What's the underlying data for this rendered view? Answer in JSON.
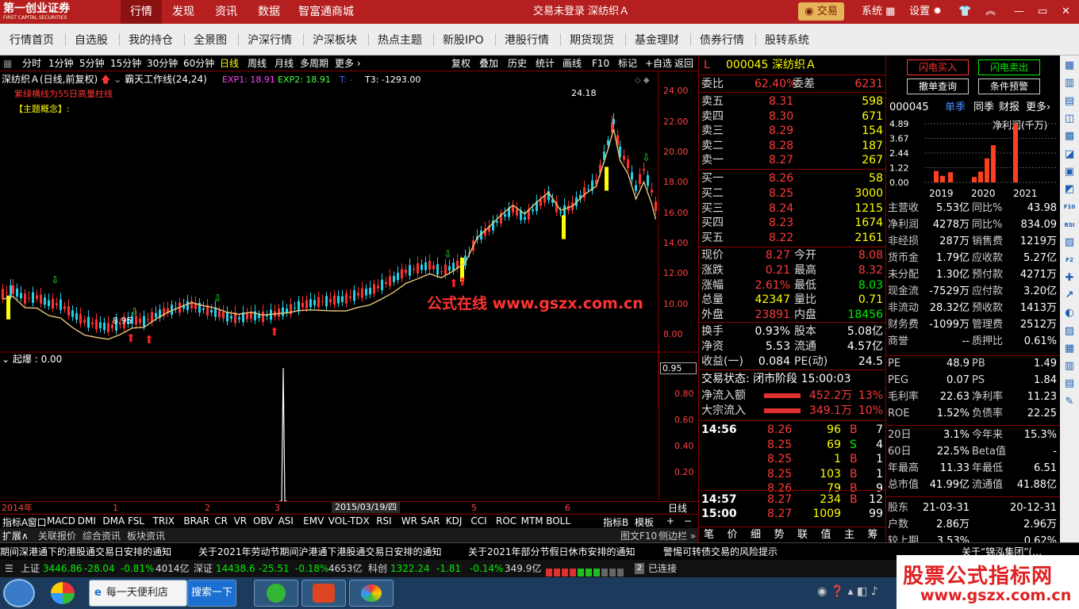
{
  "topbar": {
    "logo": "第一创业证券",
    "logo_en": "FIRST CAPITAL SECURITIES",
    "tabs": [
      "行情",
      "发现",
      "资讯",
      "数据",
      "智富通商城"
    ],
    "account": "交易未登录  深纺织Ａ",
    "trade": "交易",
    "system": "系统",
    "settings": "设置"
  },
  "nav": [
    "行情首页",
    "自选股",
    "我的持仓",
    "全景图",
    "沪深行情",
    "沪深板块",
    "热点主题",
    "新股IPO",
    "港股行情",
    "期货现货",
    "基金理财",
    "债券行情",
    "股转系统"
  ],
  "periods": [
    "分时",
    "1分钟",
    "5分钟",
    "15分钟",
    "30分钟",
    "60分钟",
    "日线",
    "周线",
    "月线",
    "多周期",
    "更多"
  ],
  "tools": [
    "复权",
    "叠加",
    "历史",
    "统计",
    "画线",
    "F10",
    "标记",
    "+自选",
    "返回"
  ],
  "main_header": {
    "stock": "深纺织Ａ(日线,前复权)",
    "indicator": "霸天工作线(24,24)",
    "exp1": "EXP1: 18.91",
    "exp2": "EXP2: 18.91",
    "t": "T: -",
    "t3": "T3: -1293.00"
  },
  "notes": {
    "line1": "紫绿横线为55日高量柱线",
    "line2": "【主题概念】:"
  },
  "yaxis": [
    "24.00",
    "22.00",
    "20.00",
    "18.00",
    "16.00",
    "14.00",
    "12.00",
    "10.00",
    "8.00"
  ],
  "annot": {
    "high": "24.18",
    "low": "8.95",
    "watermark": "公式在线  www.gszx.com.cn"
  },
  "sub": {
    "label": "起爆 : 0.00",
    "value": "0.95",
    "yaxis": [
      "0.80",
      "0.60",
      "0.40",
      "0.20"
    ]
  },
  "xaxis": {
    "year": "2014年",
    "m1": "1",
    "m2": "2",
    "m3": "3",
    "date": "2015/03/19/四",
    "m5": "5",
    "m6": "6",
    "period": "日线"
  },
  "bottom_tabs": [
    "指标A",
    "窗口",
    "MACD",
    "DMI",
    "DMA",
    "FSL",
    "TRIX",
    "BRAR",
    "CR",
    "VR",
    "OBV",
    "ASI",
    "EMV",
    "VOL-TDX",
    "RSI",
    "WR",
    "SAR",
    "KDJ",
    "CCI",
    "ROC",
    "MTM",
    "BOLL"
  ],
  "bottom_right": [
    "指标B",
    "模板"
  ],
  "ext": [
    "扩展∧",
    "关联报价",
    "综合资讯",
    "板块资讯"
  ],
  "ext_right": [
    "图文F10",
    "侧边栏"
  ],
  "quote": {
    "code": "000045",
    "name": "深纺织Ａ",
    "weibi": "62.40%",
    "weicha": "6231",
    "asks": [
      {
        "l": "卖五",
        "p": "8.31",
        "v": "598"
      },
      {
        "l": "卖四",
        "p": "8.30",
        "v": "671"
      },
      {
        "l": "卖三",
        "p": "8.29",
        "v": "154"
      },
      {
        "l": "卖二",
        "p": "8.28",
        "v": "187"
      },
      {
        "l": "卖一",
        "p": "8.27",
        "v": "267"
      }
    ],
    "bids": [
      {
        "l": "买一",
        "p": "8.26",
        "v": "58"
      },
      {
        "l": "买二",
        "p": "8.25",
        "v": "3000"
      },
      {
        "l": "买三",
        "p": "8.24",
        "v": "1215"
      },
      {
        "l": "买四",
        "p": "8.23",
        "v": "1674"
      },
      {
        "l": "买五",
        "p": "8.22",
        "v": "2161"
      }
    ],
    "stats": [
      [
        "现价",
        "8.27",
        "今开",
        "8.08"
      ],
      [
        "涨跌",
        "0.21",
        "最高",
        "8.32"
      ],
      [
        "涨幅",
        "2.61%",
        "最低",
        "8.03"
      ],
      [
        "总量",
        "42347",
        "量比",
        "0.71"
      ],
      [
        "外盘",
        "23891",
        "内盘",
        "18456"
      ]
    ],
    "stats2": [
      [
        "换手",
        "0.93%",
        "股本",
        "5.08亿"
      ],
      [
        "净资",
        "5.53",
        "流通",
        "4.57亿"
      ],
      [
        "收益(一)",
        "0.084",
        "PE(动)",
        "24.5"
      ]
    ],
    "state": "交易状态: 闭市阶段 15:00:03",
    "flows": [
      [
        "净流入额",
        "452.2万",
        "13%"
      ],
      [
        "大宗流入",
        "349.1万",
        "10%"
      ]
    ],
    "ticks": [
      [
        "14:56",
        "8.26",
        "96",
        "B",
        "7"
      ],
      [
        "",
        "8.25",
        "69",
        "S",
        "4"
      ],
      [
        "",
        "8.25",
        "1",
        "B",
        "1"
      ],
      [
        "",
        "8.25",
        "103",
        "B",
        "1"
      ],
      [
        "",
        "8.26",
        "79",
        "B",
        "9"
      ],
      [
        "14:57",
        "8.27",
        "234",
        "B",
        "12"
      ],
      [
        "15:00",
        "8.27",
        "1009",
        "",
        "99"
      ]
    ],
    "tabs": [
      "笔",
      "价",
      "细",
      "势",
      "联",
      "值",
      "主",
      "筹"
    ]
  },
  "fin": {
    "buy": "闪电买入",
    "sell": "闪电卖出",
    "cancel": "撤单查询",
    "alert": "条件预警",
    "code": "000045",
    "tabs": [
      "单季",
      "同季",
      "财报",
      "更多"
    ],
    "chart_title": "净利润(千万)",
    "yaxis": [
      "4.89",
      "3.67",
      "2.44",
      "1.22",
      "0.00"
    ],
    "years": [
      "2019",
      "2020",
      "2021"
    ],
    "rows": [
      [
        "主营收",
        "5.53亿",
        "同比%",
        "43.98"
      ],
      [
        "净利润",
        "4278万",
        "同比%",
        "834.09"
      ],
      [
        "非经损",
        "287万",
        "销售费",
        "1219万"
      ],
      [
        "货币金",
        "1.79亿",
        "应收款",
        "5.27亿"
      ],
      [
        "未分配",
        "1.30亿",
        "预付款",
        "4271万"
      ],
      [
        "现金流",
        "-7529万",
        "应付款",
        "3.20亿"
      ],
      [
        "非流动",
        "28.32亿",
        "预收款",
        "1413万"
      ],
      [
        "财务费",
        "-1099万",
        "管理费",
        "2512万"
      ],
      [
        "商誉",
        "--",
        "质押比",
        "0.61%"
      ]
    ],
    "rows2": [
      [
        "PE",
        "48.9",
        "PB",
        "1.49"
      ],
      [
        "PEG",
        "0.07",
        "PS",
        "1.84"
      ],
      [
        "毛利率",
        "22.63",
        "净利率",
        "11.23"
      ],
      [
        "ROE",
        "1.52%",
        "负债率",
        "22.25"
      ]
    ],
    "rows3": [
      [
        "20日",
        "3.1%",
        "今年来",
        "15.3%"
      ],
      [
        "60日",
        "22.5%",
        "Beta值",
        "-"
      ],
      [
        "年最高",
        "11.33",
        "年最低",
        "6.51"
      ],
      [
        "总市值",
        "41.99亿",
        "流通值",
        "41.88亿"
      ]
    ],
    "rows4": [
      [
        "股东",
        "21-03-31",
        "",
        "20-12-31"
      ],
      [
        "户数",
        "2.86万",
        "",
        "2.96万"
      ],
      [
        "较上期",
        "3.53%",
        "",
        "0.62%"
      ]
    ]
  },
  "news": [
    "期间深港通下的港股通交易日安排的通知",
    "关于2021年劳动节期间沪港通下港股通交易日安排的通知",
    "关于2021年部分节假日休市安排的通知",
    "警惕可转债交易的风险提示",
    "关于“锦泓集团”(…"
  ],
  "status": {
    "sh": "上证",
    "sh_v": "3446.86",
    "sh_c": "-28.04",
    "sh_p": "-0.81%",
    "sh_a": "4014亿",
    "sz": "深证",
    "sz_v": "14438.6",
    "sz_c": "-25.51",
    "sz_p": "-0.18%",
    "sz_a": "4653亿",
    "kc": "科创",
    "kc_v": "1322.24",
    "kc_c": "-1.81",
    "kc_p": "-0.14%",
    "kc_a": "349.9亿",
    "conn": "已连接",
    "conn_n": "2"
  },
  "taskbar": {
    "ie": "每一天便利店",
    "search": "搜索一下"
  },
  "ad": {
    "title": "股票公式指标网",
    "url": "www.gszx.com.cn"
  }
}
